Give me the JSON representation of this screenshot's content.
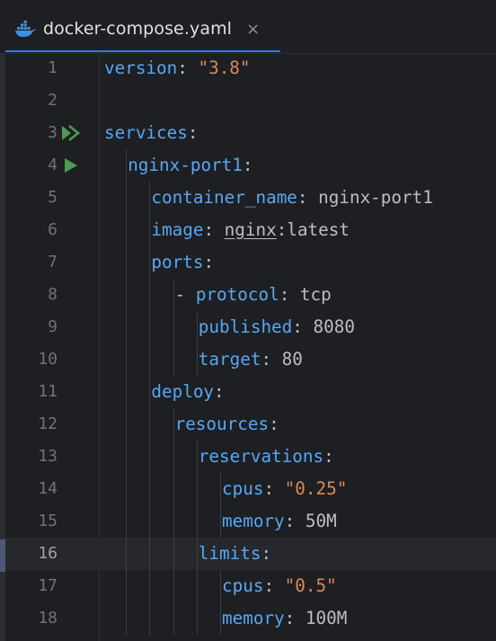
{
  "tab": {
    "icon": "docker-icon",
    "filename": "docker-compose.yaml",
    "close_glyph": "×",
    "accent": "#3574f0"
  },
  "editor": {
    "current_line": 16,
    "colors": {
      "key": "#56a8f5",
      "string": "#d88a58",
      "text": "#bcbec4",
      "line_number": "#6f737a",
      "run_icon": "#499c54"
    },
    "lines": [
      {
        "n": "1",
        "indent": 0,
        "key": "version",
        "sep": ": ",
        "value": "\"3.8\"",
        "value_type": "string"
      },
      {
        "n": "2",
        "indent": 0,
        "key": "",
        "sep": "",
        "value": "",
        "value_type": "plain"
      },
      {
        "n": "3",
        "indent": 0,
        "key": "services",
        "sep": ":",
        "value": "",
        "value_type": "plain",
        "run_icon": "run-all-icon"
      },
      {
        "n": "4",
        "indent": 1,
        "key": "nginx-port1",
        "sep": ":",
        "value": "",
        "value_type": "plain",
        "run_icon": "run-icon"
      },
      {
        "n": "5",
        "indent": 2,
        "key": "container_name",
        "sep": ": ",
        "value": "nginx-port1",
        "value_type": "plain"
      },
      {
        "n": "6",
        "indent": 2,
        "key": "image",
        "sep": ": ",
        "value_link": "nginx",
        "value_rest": ":latest",
        "value_type": "image"
      },
      {
        "n": "7",
        "indent": 2,
        "key": "ports",
        "sep": ":",
        "value": "",
        "value_type": "plain"
      },
      {
        "n": "8",
        "indent": 3,
        "dash": "- ",
        "key": "protocol",
        "sep": ": ",
        "value": "tcp",
        "value_type": "plain"
      },
      {
        "n": "9",
        "indent": 4,
        "key": "published",
        "sep": ": ",
        "value": "8080",
        "value_type": "plain"
      },
      {
        "n": "10",
        "indent": 4,
        "key": "target",
        "sep": ": ",
        "value": "80",
        "value_type": "plain"
      },
      {
        "n": "11",
        "indent": 2,
        "key": "deploy",
        "sep": ":",
        "value": "",
        "value_type": "plain"
      },
      {
        "n": "12",
        "indent": 3,
        "key": "resources",
        "sep": ":",
        "value": "",
        "value_type": "plain"
      },
      {
        "n": "13",
        "indent": 4,
        "key": "reservations",
        "sep": ":",
        "value": "",
        "value_type": "plain"
      },
      {
        "n": "14",
        "indent": 5,
        "key": "cpus",
        "sep": ": ",
        "value": "\"0.25\"",
        "value_type": "string"
      },
      {
        "n": "15",
        "indent": 5,
        "key": "memory",
        "sep": ": ",
        "value": "50M",
        "value_type": "plain"
      },
      {
        "n": "16",
        "indent": 4,
        "key": "limits",
        "sep": ":",
        "value": "",
        "value_type": "plain"
      },
      {
        "n": "17",
        "indent": 5,
        "key": "cpus",
        "sep": ": ",
        "value": "\"0.5\"",
        "value_type": "string"
      },
      {
        "n": "18",
        "indent": 5,
        "key": "memory",
        "sep": ": ",
        "value": "100M",
        "value_type": "plain"
      }
    ]
  }
}
